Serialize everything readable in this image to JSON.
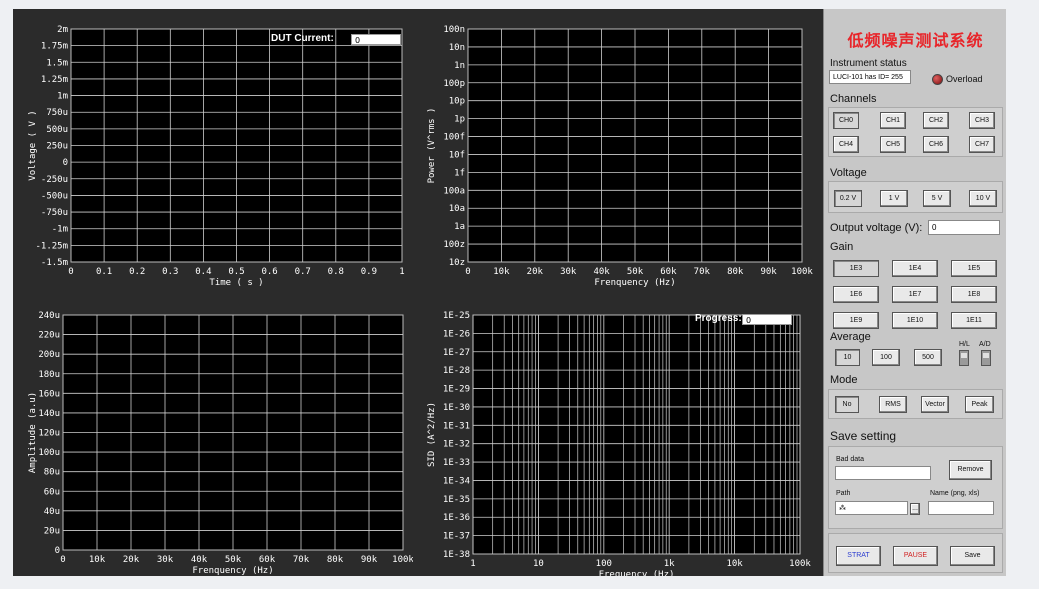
{
  "panel": {
    "title": "低频噪声测试系统",
    "instrument_status_label": "Instrument status",
    "instrument_status_value": "LUCI-101 has ID= 255",
    "overload_label": "Overload",
    "channels_label": "Channels",
    "channels": [
      "CH0",
      "CH1",
      "CH2",
      "CH3",
      "CH4",
      "CH5",
      "CH6",
      "CH7"
    ],
    "voltage_label": "Voltage",
    "voltage_options": [
      "0.2 V",
      "1 V",
      "5 V",
      "10 V"
    ],
    "output_voltage_label": "Output voltage (V):",
    "output_voltage_value": "0",
    "gain_label": "Gain",
    "gain_options": [
      "1E3",
      "1E4",
      "1E5",
      "1E6",
      "1E7",
      "1E8",
      "1E9",
      "1E10",
      "1E11"
    ],
    "average_label": "Average",
    "average_options": [
      "10",
      "100",
      "500"
    ],
    "hl_label": "H/L",
    "ad_label": "A/D",
    "mode_label": "Mode",
    "mode_options": [
      "No",
      "RMS",
      "Vector",
      "Peak"
    ],
    "save_label": "Save setting",
    "bad_data_label": "Bad data",
    "remove_label": "Remove",
    "path_label": "Path",
    "path_browse": "...",
    "name_label": "Name (png, xls)",
    "strat_label": "STRAT",
    "pause_label": "PAUSE",
    "save_button_label": "Save",
    "accent": "#e8252a"
  },
  "plots": {
    "time": {
      "ylabel": "Voltage ( V )",
      "xlabel": "Time ( s )",
      "yticks": [
        "2m",
        "1.75m",
        "1.5m",
        "1.25m",
        "1m",
        "750u",
        "500u",
        "250u",
        "0",
        "-250u",
        "-500u",
        "-750u",
        "-1m",
        "-1.25m",
        "-1.5m"
      ],
      "xticks": [
        "0",
        "0.1",
        "0.2",
        "0.3",
        "0.4",
        "0.5",
        "0.6",
        "0.7",
        "0.8",
        "0.9",
        "1"
      ],
      "field_label": "DUT Current:",
      "field_value": "0"
    },
    "power": {
      "ylabel": "Power (V^rms )",
      "xlabel": "Frenquency (Hz)",
      "yticks": [
        "100n",
        "10n",
        "1n",
        "100p",
        "10p",
        "1p",
        "100f",
        "10f",
        "1f",
        "100a",
        "10a",
        "1a",
        "100z",
        "10z"
      ],
      "xticks": [
        "0",
        "10k",
        "20k",
        "30k",
        "40k",
        "50k",
        "60k",
        "70k",
        "80k",
        "90k",
        "100k"
      ]
    },
    "amplitude": {
      "ylabel": "Amplitude (a.u)",
      "xlabel": "Frenquency (Hz)",
      "yticks": [
        "240u",
        "220u",
        "200u",
        "180u",
        "160u",
        "140u",
        "120u",
        "100u",
        "80u",
        "60u",
        "40u",
        "20u",
        "0"
      ],
      "xticks": [
        "0",
        "10k",
        "20k",
        "30k",
        "40k",
        "50k",
        "60k",
        "70k",
        "80k",
        "90k",
        "100k"
      ]
    },
    "sid": {
      "ylabel": "SID (A^2/Hz)",
      "xlabel": "Frequency (Hz)",
      "yticks": [
        "1E-25",
        "1E-26",
        "1E-27",
        "1E-28",
        "1E-29",
        "1E-30",
        "1E-31",
        "1E-32",
        "1E-33",
        "1E-34",
        "1E-35",
        "1E-36",
        "1E-37",
        "1E-38"
      ],
      "xticks": [
        "1",
        "10",
        "100",
        "1k",
        "10k",
        "100k"
      ],
      "field_label": "Progress:",
      "field_value": "0"
    }
  }
}
